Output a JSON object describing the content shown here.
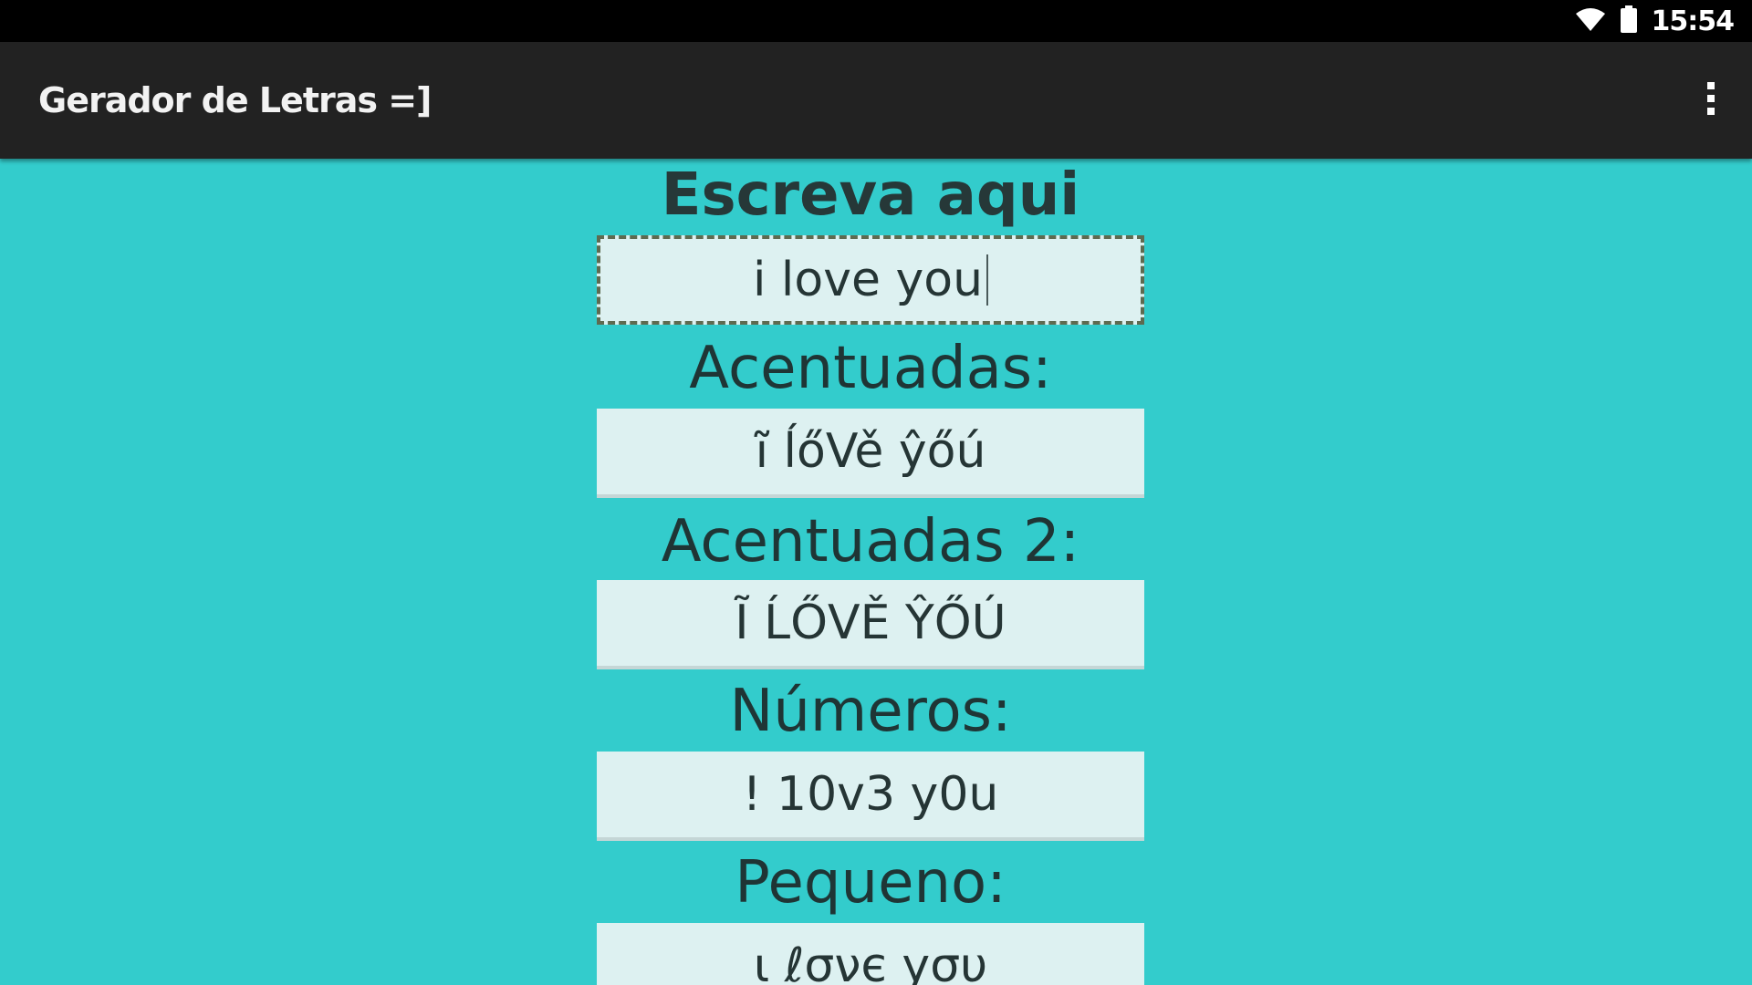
{
  "status_bar": {
    "time": "15:54",
    "icons": [
      "wifi-icon",
      "battery-icon"
    ]
  },
  "action_bar": {
    "title": "Gerador de Letras =]",
    "overflow_icon": "overflow-menu-icon"
  },
  "colors": {
    "background": "#33CCCC",
    "action_bar": "#222222",
    "field": "#DDF1F1"
  },
  "input": {
    "label": "Escreva aqui",
    "value": "i love you"
  },
  "sections": [
    {
      "label": "Acentuadas:",
      "value": "ĩ ĺőVě ŷőú"
    },
    {
      "label": "Acentuadas 2:",
      "value": "Ĩ ĹŐVĚ ŶŐÚ"
    },
    {
      "label": "Números:",
      "value": "! 10v3 y0u"
    },
    {
      "label": "Pequeno:",
      "value": "ι ℓσνє уσυ"
    }
  ]
}
